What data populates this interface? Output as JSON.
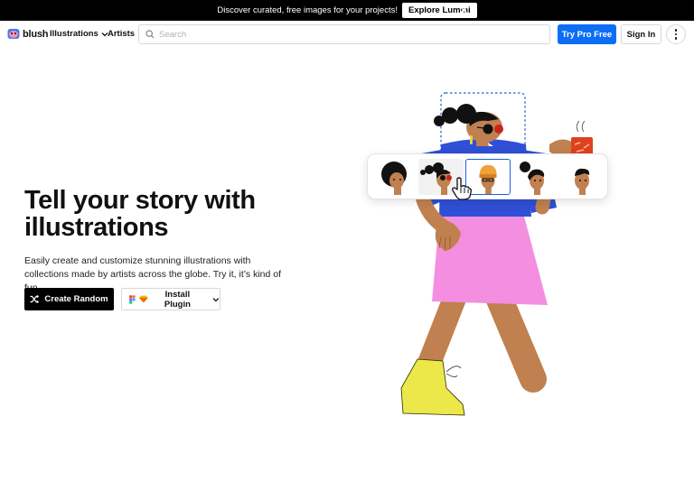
{
  "promo": {
    "message": "Discover curated, free images for your projects!",
    "cta_label": "Explore Lummi"
  },
  "nav": {
    "brand": "blush",
    "illustrations_label": "Illustrations",
    "artists_label": "Artists",
    "search_placeholder": "Search",
    "search_value": "",
    "pro_label": "Try Pro Free",
    "signin_label": "Sign In"
  },
  "hero": {
    "title": "Tell your story with illustrations",
    "subtitle": "Easily create and customize stunning illustrations with collections made by artists across the globe. Try it, it’s kind of fun.",
    "random_label": "Create Random",
    "plugin_label": "Install Plugin"
  },
  "colors": {
    "accent": "#0b6ef5",
    "skirt": "#f48ee0",
    "top": "#2f4fd6",
    "skin": "#c0804f",
    "shoe": "#ece84a"
  },
  "picker": {
    "selected_index": 2,
    "variant_count": 5
  }
}
